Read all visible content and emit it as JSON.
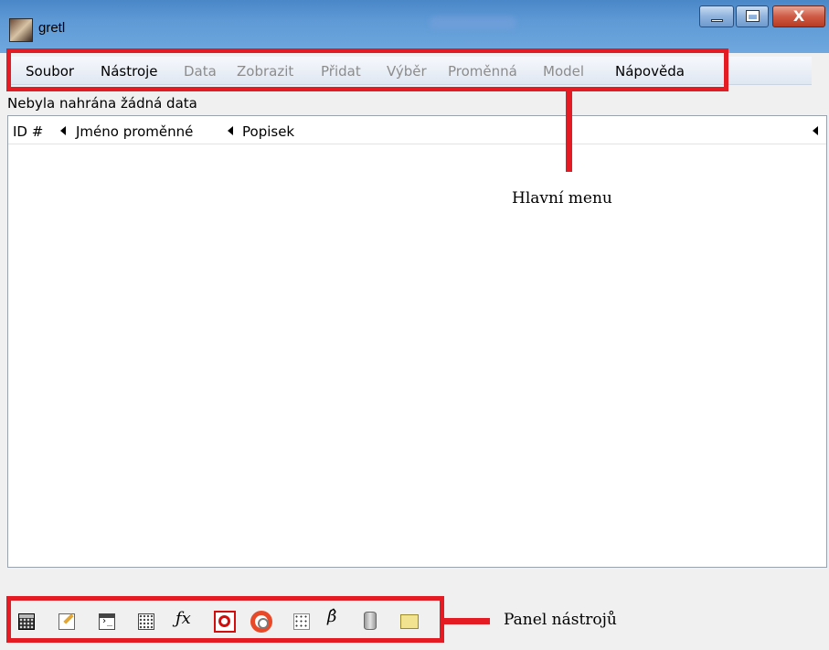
{
  "window": {
    "title": "gretl",
    "controls": {
      "minimize": "minimize",
      "maximize": "maximize",
      "close": "X"
    }
  },
  "menubar": {
    "items": [
      {
        "label": "Soubor",
        "enabled": true
      },
      {
        "label": "Nástroje",
        "enabled": true
      },
      {
        "label": "Data",
        "enabled": false
      },
      {
        "label": "Zobrazit",
        "enabled": false
      },
      {
        "label": "Přidat",
        "enabled": false
      },
      {
        "label": "Výběr",
        "enabled": false
      },
      {
        "label": "Proměnná",
        "enabled": false
      },
      {
        "label": "Model",
        "enabled": false
      },
      {
        "label": "Nápověda",
        "enabled": true
      }
    ]
  },
  "status": {
    "text": "Nebyla nahrána žádná data"
  },
  "variables_table": {
    "columns": [
      {
        "label": "ID #"
      },
      {
        "label": "Jméno proměnné"
      },
      {
        "label": "Popisek"
      }
    ],
    "rows": []
  },
  "toolbar": {
    "icons": [
      "calculator-icon",
      "edit-script-icon",
      "console-icon",
      "matrix-icon",
      "function-package-icon",
      "pdf-guide-icon",
      "help-icon",
      "plot-icon",
      "estimate-model-icon",
      "database-icon",
      "open-folder-icon"
    ],
    "fx_label": "ƒx",
    "beta_label": "β̂"
  },
  "annotations": {
    "main_menu": "Hlavní menu",
    "toolbar": "Panel nástrojů"
  },
  "colors": {
    "highlight": "#e51b24",
    "titlebar": "#5f9ad6",
    "disabled_text": "#8c8c8c"
  }
}
